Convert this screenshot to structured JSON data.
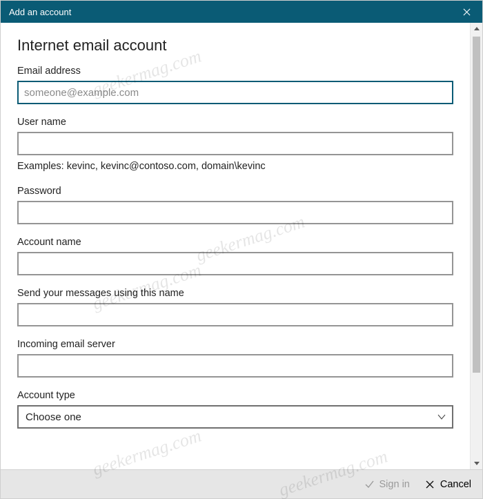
{
  "titlebar": {
    "title": "Add an account"
  },
  "heading": "Internet email account",
  "fields": {
    "email": {
      "label": "Email address",
      "placeholder": "someone@example.com",
      "value": ""
    },
    "username": {
      "label": "User name",
      "value": "",
      "help": "Examples: kevinc, kevinc@contoso.com, domain\\kevinc"
    },
    "password": {
      "label": "Password",
      "value": ""
    },
    "accountname": {
      "label": "Account name",
      "value": ""
    },
    "sendname": {
      "label": "Send your messages using this name",
      "value": ""
    },
    "incoming": {
      "label": "Incoming email server",
      "value": ""
    },
    "accounttype": {
      "label": "Account type",
      "selected": "Choose one"
    }
  },
  "footer": {
    "signin": "Sign in",
    "cancel": "Cancel"
  },
  "watermark": "geekermag.com"
}
